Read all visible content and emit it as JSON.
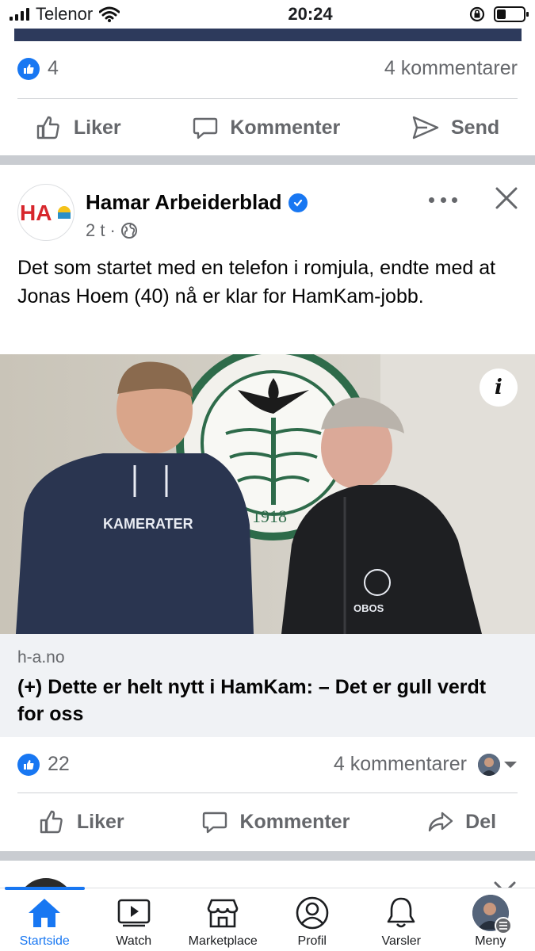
{
  "status_bar": {
    "carrier": "Telenor",
    "time": "20:24",
    "battery_level": 0.35
  },
  "previous_post": {
    "likes": "4",
    "comments": "4 kommentarer",
    "actions": {
      "like": "Liker",
      "comment": "Kommenter",
      "send": "Send"
    }
  },
  "post": {
    "page_name": "Hamar Arbeiderblad",
    "logo_text": "HA",
    "time_ago": "2 t",
    "meta_separator": "·",
    "text": "Det som startet med en telefon i romjula, endte med at Jonas Hoem (40) nå er klar for HamKam-jobb.",
    "image": {
      "badge_text": "KAMERATER",
      "info_label": "i"
    },
    "link": {
      "domain": "h-a.no",
      "title": "(+) Dette er helt nytt i HamKam: – Det er gull verdt for oss"
    },
    "likes": "22",
    "comments": "4 kommentarer",
    "actions": {
      "like": "Liker",
      "comment": "Kommenter",
      "share": "Del"
    }
  },
  "bottom_nav": {
    "items": [
      {
        "label": "Startside",
        "icon": "home-icon",
        "active": true
      },
      {
        "label": "Watch",
        "icon": "watch-icon",
        "active": false
      },
      {
        "label": "Marketplace",
        "icon": "marketplace-icon",
        "active": false
      },
      {
        "label": "Profil",
        "icon": "profile-icon",
        "active": false
      },
      {
        "label": "Varsler",
        "icon": "bell-icon",
        "active": false
      },
      {
        "label": "Meny",
        "icon": "menu-avatar",
        "active": false
      }
    ]
  },
  "colors": {
    "accent": "#1877f2",
    "text_secondary": "#65676b",
    "separator": "#c9ccd1"
  }
}
